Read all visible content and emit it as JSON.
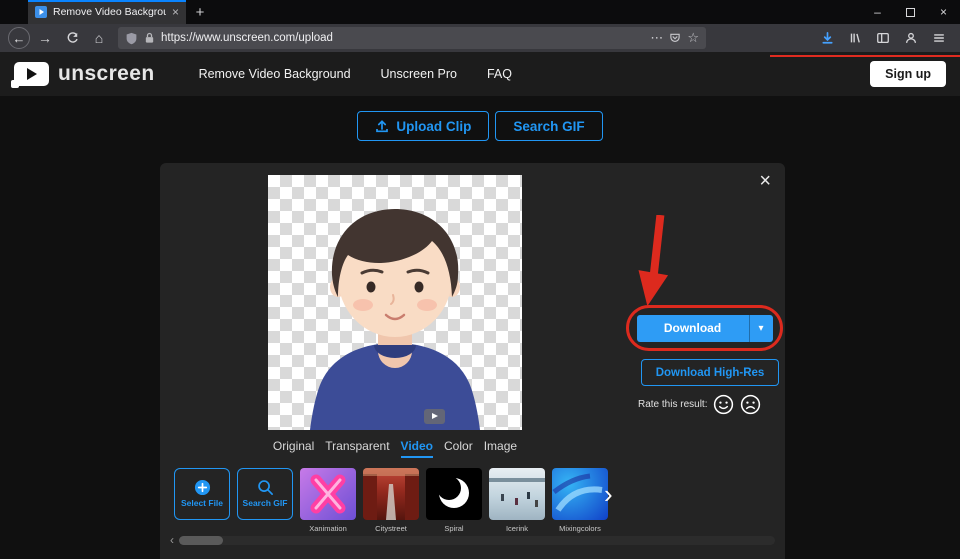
{
  "browser": {
    "tab_title": "Remove Video Background",
    "url": "https://www.unscreen.com/upload"
  },
  "icons": {
    "back_arrow": "←",
    "forward_arrow": "→",
    "home": "⌂",
    "page_actions": "⋯",
    "bookmark_star": "☆",
    "new_tab": "+",
    "close_tab": "×",
    "minimize": "–",
    "close_window": "×",
    "caret_down": "▾",
    "carousel_next": "›",
    "scroll_left": "‹",
    "panel_close": "×"
  },
  "site_header": {
    "brand": "unscreen",
    "nav_items": [
      {
        "label": "Remove Video Background"
      },
      {
        "label": "Unscreen Pro"
      },
      {
        "label": "FAQ"
      }
    ],
    "signup_label": "Sign up"
  },
  "actions": {
    "upload_clip_label": "Upload Clip",
    "search_gif_label": "Search GIF"
  },
  "result_panel": {
    "download_label": "Download",
    "download_highres_label": "Download High-Res",
    "rate_label": "Rate this result:",
    "tabs": [
      {
        "label": "Original",
        "active": false
      },
      {
        "label": "Transparent",
        "active": false
      },
      {
        "label": "Video",
        "active": true
      },
      {
        "label": "Color",
        "active": false
      },
      {
        "label": "Image",
        "active": false
      }
    ],
    "select_file_label": "Select File",
    "search_gif_label": "Search GIF",
    "thumbnails": [
      {
        "label": "Xanimation"
      },
      {
        "label": "Citystreet"
      },
      {
        "label": "Spiral"
      },
      {
        "label": "Icerink"
      },
      {
        "label": "Mixingcolors"
      }
    ]
  },
  "colors": {
    "accent_blue": "#2196f3",
    "download_button_blue": "#2e9cf5",
    "annotation_red": "#dd2a1e"
  }
}
